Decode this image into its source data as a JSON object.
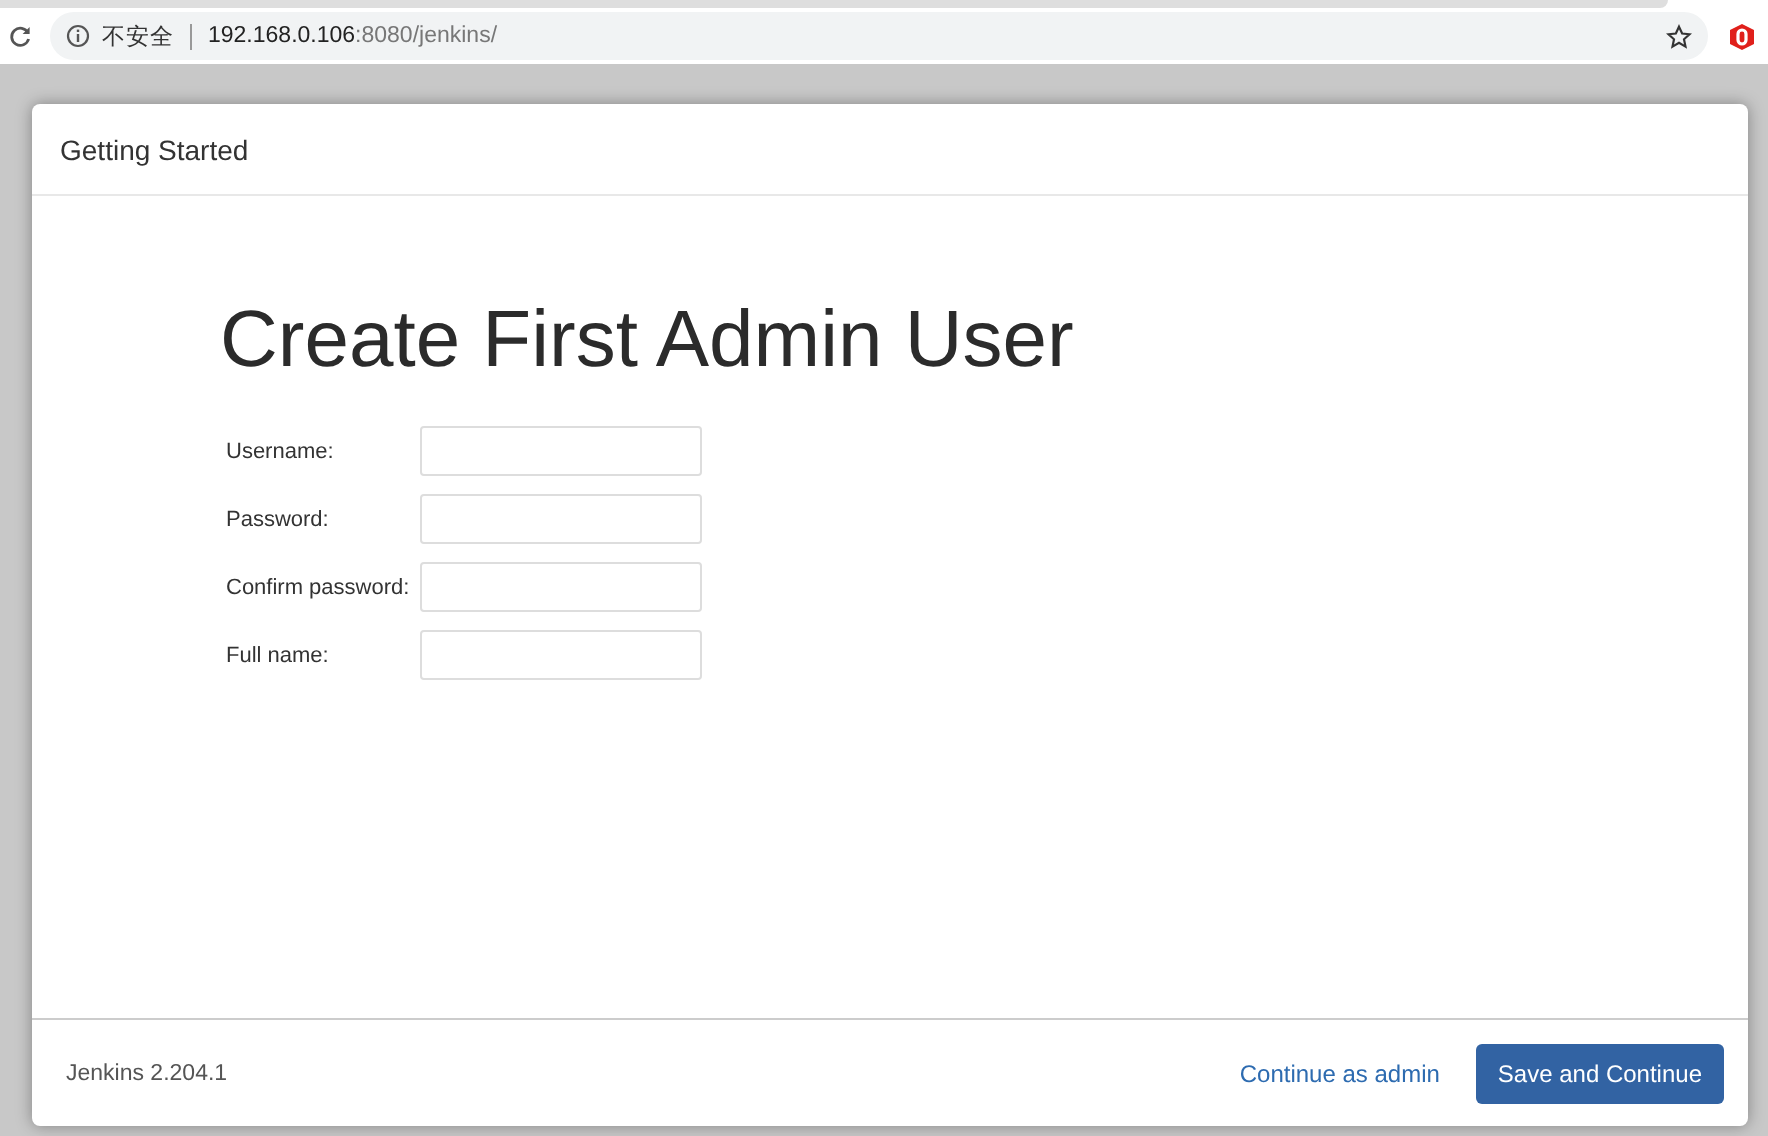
{
  "browser": {
    "security_label": "不安全",
    "url_host": "192.168.0.106",
    "url_rest": ":8080/jenkins/"
  },
  "dialog": {
    "title": "Getting Started",
    "heading": "Create First Admin User",
    "fields": [
      {
        "label": "Username:"
      },
      {
        "label": "Password:"
      },
      {
        "label": "Confirm password:"
      },
      {
        "label": "Full name:"
      }
    ],
    "version": "Jenkins 2.204.1",
    "link": "Continue as admin",
    "button": "Save and Continue"
  }
}
